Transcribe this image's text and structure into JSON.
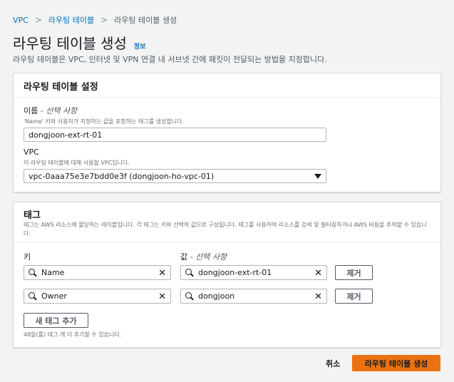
{
  "breadcrumb": {
    "items": [
      "VPC",
      "라우팅 테이블",
      "라우팅 테이블 생성"
    ],
    "separator": ">"
  },
  "page": {
    "title": "라우팅 테이블 생성",
    "info_link": "정보",
    "description": "라우팅 테이블은 VPC, 인터넷 및 VPN 연결 내 서브넷 간에 패킷이 전달되는 방법을 지정합니다."
  },
  "settings": {
    "heading": "라우팅 테이블 설정",
    "name_label": "이름",
    "name_optional": " - 선택 사항",
    "name_hint": "'Name' 키와 사용자가 지정하는 값을 포함하는 태그를 생성합니다.",
    "name_value": "dongjoon-ext-rt-01",
    "vpc_label": "VPC",
    "vpc_hint": "이 라우팅 테이블에 대해 사용할 VPC입니다.",
    "vpc_value": "vpc-0aaa75e3e7bdd0e3f (dongjoon-ho-vpc-01)"
  },
  "tags": {
    "heading": "태그",
    "description": "태그는 AWS 리소스에 할당하는 레이블입니다. 각 태그는 키와 선택적 값으로 구성됩니다. 태그를 사용하여 리소스를 검색 및 필터링하거나 AWS 비용을 추적할 수 있습니다.",
    "key_header": "키",
    "value_header": "값",
    "value_optional": " - 선택 사항",
    "rows": [
      {
        "key": "Name",
        "value": "dongjoon-ext-rt-01",
        "remove": "제거"
      },
      {
        "key": "Owner",
        "value": "dongjoon",
        "remove": "제거"
      }
    ],
    "add_button": "새 태그 추가",
    "limit_note": "48을(를) 태그.개 더 추가할 수 있습니다."
  },
  "footer": {
    "cancel": "취소",
    "submit": "라우팅 테이블 생성"
  },
  "colors": {
    "link": "#0073bb",
    "primary": "#ec7211",
    "background": "#f2f3f3"
  }
}
